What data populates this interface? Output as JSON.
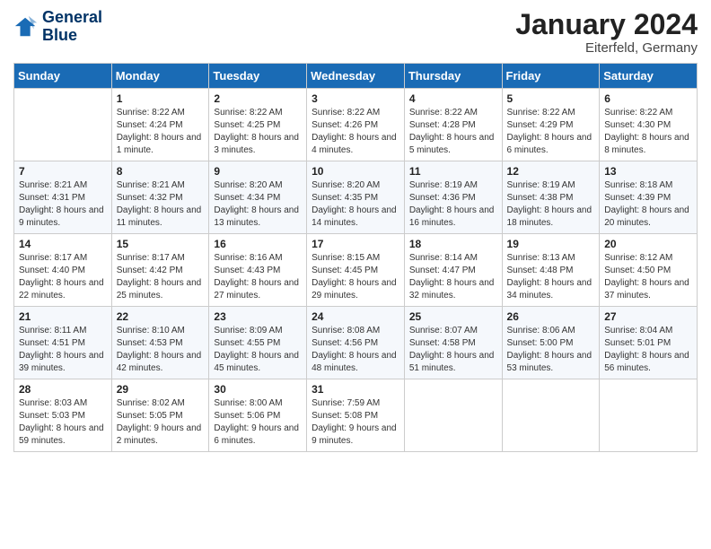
{
  "logo": {
    "name": "GeneralBlue",
    "line1": "General",
    "line2": "Blue"
  },
  "header": {
    "title": "January 2024",
    "subtitle": "Eiterfeld, Germany"
  },
  "columns": [
    "Sunday",
    "Monday",
    "Tuesday",
    "Wednesday",
    "Thursday",
    "Friday",
    "Saturday"
  ],
  "weeks": [
    [
      {
        "day": "",
        "sunrise": "",
        "sunset": "",
        "daylight": ""
      },
      {
        "day": "1",
        "sunrise": "Sunrise: 8:22 AM",
        "sunset": "Sunset: 4:24 PM",
        "daylight": "Daylight: 8 hours and 1 minute."
      },
      {
        "day": "2",
        "sunrise": "Sunrise: 8:22 AM",
        "sunset": "Sunset: 4:25 PM",
        "daylight": "Daylight: 8 hours and 3 minutes."
      },
      {
        "day": "3",
        "sunrise": "Sunrise: 8:22 AM",
        "sunset": "Sunset: 4:26 PM",
        "daylight": "Daylight: 8 hours and 4 minutes."
      },
      {
        "day": "4",
        "sunrise": "Sunrise: 8:22 AM",
        "sunset": "Sunset: 4:28 PM",
        "daylight": "Daylight: 8 hours and 5 minutes."
      },
      {
        "day": "5",
        "sunrise": "Sunrise: 8:22 AM",
        "sunset": "Sunset: 4:29 PM",
        "daylight": "Daylight: 8 hours and 6 minutes."
      },
      {
        "day": "6",
        "sunrise": "Sunrise: 8:22 AM",
        "sunset": "Sunset: 4:30 PM",
        "daylight": "Daylight: 8 hours and 8 minutes."
      }
    ],
    [
      {
        "day": "7",
        "sunrise": "Sunrise: 8:21 AM",
        "sunset": "Sunset: 4:31 PM",
        "daylight": "Daylight: 8 hours and 9 minutes."
      },
      {
        "day": "8",
        "sunrise": "Sunrise: 8:21 AM",
        "sunset": "Sunset: 4:32 PM",
        "daylight": "Daylight: 8 hours and 11 minutes."
      },
      {
        "day": "9",
        "sunrise": "Sunrise: 8:20 AM",
        "sunset": "Sunset: 4:34 PM",
        "daylight": "Daylight: 8 hours and 13 minutes."
      },
      {
        "day": "10",
        "sunrise": "Sunrise: 8:20 AM",
        "sunset": "Sunset: 4:35 PM",
        "daylight": "Daylight: 8 hours and 14 minutes."
      },
      {
        "day": "11",
        "sunrise": "Sunrise: 8:19 AM",
        "sunset": "Sunset: 4:36 PM",
        "daylight": "Daylight: 8 hours and 16 minutes."
      },
      {
        "day": "12",
        "sunrise": "Sunrise: 8:19 AM",
        "sunset": "Sunset: 4:38 PM",
        "daylight": "Daylight: 8 hours and 18 minutes."
      },
      {
        "day": "13",
        "sunrise": "Sunrise: 8:18 AM",
        "sunset": "Sunset: 4:39 PM",
        "daylight": "Daylight: 8 hours and 20 minutes."
      }
    ],
    [
      {
        "day": "14",
        "sunrise": "Sunrise: 8:17 AM",
        "sunset": "Sunset: 4:40 PM",
        "daylight": "Daylight: 8 hours and 22 minutes."
      },
      {
        "day": "15",
        "sunrise": "Sunrise: 8:17 AM",
        "sunset": "Sunset: 4:42 PM",
        "daylight": "Daylight: 8 hours and 25 minutes."
      },
      {
        "day": "16",
        "sunrise": "Sunrise: 8:16 AM",
        "sunset": "Sunset: 4:43 PM",
        "daylight": "Daylight: 8 hours and 27 minutes."
      },
      {
        "day": "17",
        "sunrise": "Sunrise: 8:15 AM",
        "sunset": "Sunset: 4:45 PM",
        "daylight": "Daylight: 8 hours and 29 minutes."
      },
      {
        "day": "18",
        "sunrise": "Sunrise: 8:14 AM",
        "sunset": "Sunset: 4:47 PM",
        "daylight": "Daylight: 8 hours and 32 minutes."
      },
      {
        "day": "19",
        "sunrise": "Sunrise: 8:13 AM",
        "sunset": "Sunset: 4:48 PM",
        "daylight": "Daylight: 8 hours and 34 minutes."
      },
      {
        "day": "20",
        "sunrise": "Sunrise: 8:12 AM",
        "sunset": "Sunset: 4:50 PM",
        "daylight": "Daylight: 8 hours and 37 minutes."
      }
    ],
    [
      {
        "day": "21",
        "sunrise": "Sunrise: 8:11 AM",
        "sunset": "Sunset: 4:51 PM",
        "daylight": "Daylight: 8 hours and 39 minutes."
      },
      {
        "day": "22",
        "sunrise": "Sunrise: 8:10 AM",
        "sunset": "Sunset: 4:53 PM",
        "daylight": "Daylight: 8 hours and 42 minutes."
      },
      {
        "day": "23",
        "sunrise": "Sunrise: 8:09 AM",
        "sunset": "Sunset: 4:55 PM",
        "daylight": "Daylight: 8 hours and 45 minutes."
      },
      {
        "day": "24",
        "sunrise": "Sunrise: 8:08 AM",
        "sunset": "Sunset: 4:56 PM",
        "daylight": "Daylight: 8 hours and 48 minutes."
      },
      {
        "day": "25",
        "sunrise": "Sunrise: 8:07 AM",
        "sunset": "Sunset: 4:58 PM",
        "daylight": "Daylight: 8 hours and 51 minutes."
      },
      {
        "day": "26",
        "sunrise": "Sunrise: 8:06 AM",
        "sunset": "Sunset: 5:00 PM",
        "daylight": "Daylight: 8 hours and 53 minutes."
      },
      {
        "day": "27",
        "sunrise": "Sunrise: 8:04 AM",
        "sunset": "Sunset: 5:01 PM",
        "daylight": "Daylight: 8 hours and 56 minutes."
      }
    ],
    [
      {
        "day": "28",
        "sunrise": "Sunrise: 8:03 AM",
        "sunset": "Sunset: 5:03 PM",
        "daylight": "Daylight: 8 hours and 59 minutes."
      },
      {
        "day": "29",
        "sunrise": "Sunrise: 8:02 AM",
        "sunset": "Sunset: 5:05 PM",
        "daylight": "Daylight: 9 hours and 2 minutes."
      },
      {
        "day": "30",
        "sunrise": "Sunrise: 8:00 AM",
        "sunset": "Sunset: 5:06 PM",
        "daylight": "Daylight: 9 hours and 6 minutes."
      },
      {
        "day": "31",
        "sunrise": "Sunrise: 7:59 AM",
        "sunset": "Sunset: 5:08 PM",
        "daylight": "Daylight: 9 hours and 9 minutes."
      },
      {
        "day": "",
        "sunrise": "",
        "sunset": "",
        "daylight": ""
      },
      {
        "day": "",
        "sunrise": "",
        "sunset": "",
        "daylight": ""
      },
      {
        "day": "",
        "sunrise": "",
        "sunset": "",
        "daylight": ""
      }
    ]
  ]
}
